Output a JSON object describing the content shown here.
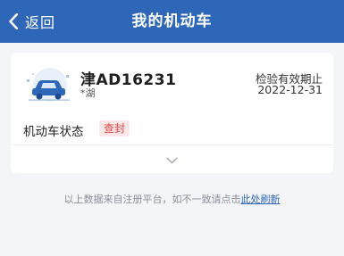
{
  "header": {
    "back_label": "返回",
    "title": "我的机动车"
  },
  "vehicle": {
    "plate": "津AD16231",
    "brand": "*湖",
    "inspection_label": "检验有效期止",
    "inspection_date": "2022-12-31",
    "status_label": "机动车状态",
    "status_value": "查封"
  },
  "footer_note": {
    "text": "以上数据来自注册平台，如不一致请点击",
    "link": "此处刷新"
  },
  "colors": {
    "header": "#2f67b8",
    "status_badge_text": "#e04848",
    "status_badge_bg": "#fde6e6",
    "link": "#2f67b8"
  },
  "icons": [
    "back-arrow-icon",
    "car-icon",
    "chevron-down-icon"
  ]
}
